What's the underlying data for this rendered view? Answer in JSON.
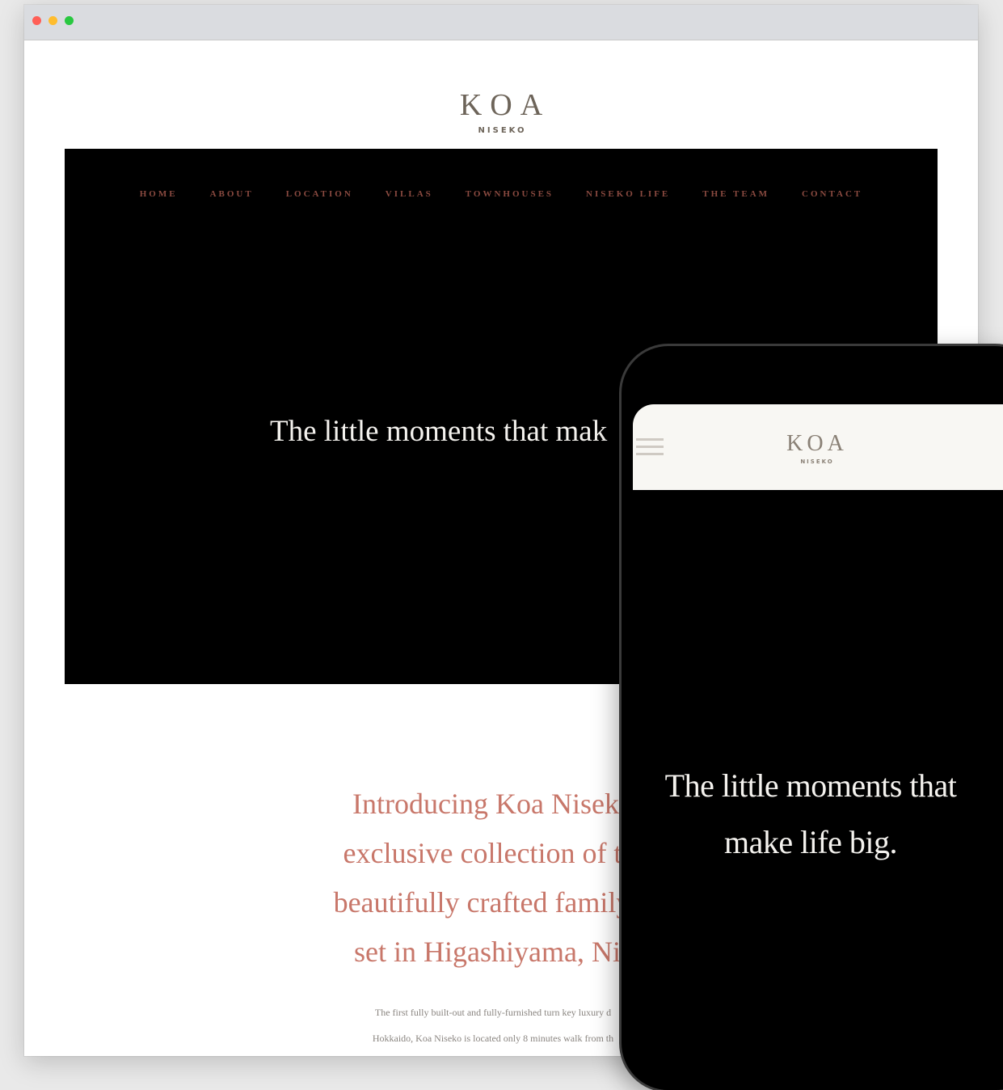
{
  "colors": {
    "accent_rose": "#c8776a",
    "nav_text": "#8a4a40",
    "logo": "#6d6459",
    "hero_bg": "#000000",
    "window_red": "#ff5f57",
    "window_yellow": "#ffbd2e",
    "window_green": "#28c840"
  },
  "window_controls": [
    "close-dot",
    "minimize-dot",
    "zoom-dot"
  ],
  "desktop": {
    "logo": {
      "main": "KOA",
      "sub": "NISEKO"
    },
    "nav": {
      "items": [
        {
          "label": "HOME"
        },
        {
          "label": "ABOUT"
        },
        {
          "label": "LOCATION"
        },
        {
          "label": "VILLAS"
        },
        {
          "label": "TOWNHOUSES"
        },
        {
          "label": "NISEKO LIFE"
        },
        {
          "label": "THE TEAM"
        },
        {
          "label": "CONTACT"
        }
      ]
    },
    "hero": {
      "headline": "The little moments that mak"
    },
    "intro": {
      "lines": [
        "Introducing Koa Niseko",
        "exclusive collection of tw",
        "beautifully crafted family h",
        "set in Higashiyama, Nis"
      ]
    },
    "body_copy": {
      "lines": [
        "The first fully built-out and fully-furnished turn key luxury d",
        "Hokkaido, Koa Niseko is located only 8 minutes walk from th"
      ]
    }
  },
  "mobile": {
    "menu_icon": "hamburger-icon",
    "logo": {
      "main": "KOA",
      "sub": "NISEKO"
    },
    "hero": {
      "headline_lines": [
        "The little moments that",
        "make life big."
      ]
    }
  }
}
